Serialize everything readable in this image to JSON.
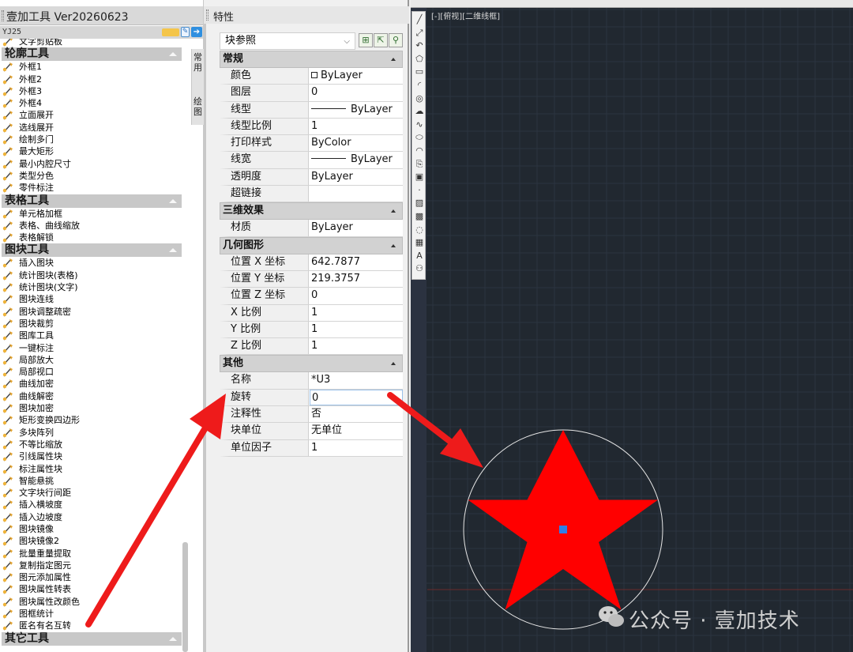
{
  "tool_panel": {
    "title": "壹加工具 Ver20260623",
    "version_tag": "YJ25",
    "badge": "",
    "partial_first_item": "文字剪贴板",
    "categories": [
      {
        "name": "轮廓工具",
        "items": [
          "外框1",
          "外框2",
          "外框3",
          "外框4",
          "立面展开",
          "选线展开",
          "绘制多门",
          "最大矩形",
          "最小内腔尺寸",
          "类型分色",
          "零件标注"
        ]
      },
      {
        "name": "表格工具",
        "items": [
          "单元格加框",
          "表格、曲线缩放",
          "表格解锁"
        ]
      },
      {
        "name": "图块工具",
        "items": [
          "插入图块",
          "统计图块(表格)",
          "统计图块(文字)",
          "图块连线",
          "图块调整疏密",
          "图块裁剪",
          "图库工具",
          "一键标注",
          "局部放大",
          "局部视口",
          "曲线加密",
          "曲线解密",
          "图块加密",
          "矩形变换四边形",
          "多块阵列",
          "不等比缩放",
          "引线属性块",
          "标注属性块",
          "智能悬挑",
          "文字块行间距",
          "插入横坡度",
          "插入边坡度",
          "图块镜像",
          "图块镜像2",
          "批量重量提取",
          "复制指定图元",
          "图元添加属性",
          "图块属性转表",
          "图块属性改颜色",
          "图框统计",
          "匿名有名互转"
        ]
      },
      {
        "name": "其它工具",
        "items": []
      }
    ],
    "side_tabs": [
      "常用",
      "绘图"
    ]
  },
  "properties": {
    "title": "特性",
    "selector_value": "块参照",
    "sections": [
      {
        "name": "常规",
        "rows": [
          {
            "key": "颜色",
            "value": "ByLayer"
          },
          {
            "key": "图层",
            "value": "0"
          },
          {
            "key": "线型",
            "value": "ByLayer"
          },
          {
            "key": "线型比例",
            "value": "1"
          },
          {
            "key": "打印样式",
            "value": "ByColor"
          },
          {
            "key": "线宽",
            "value": "ByLayer"
          },
          {
            "key": "透明度",
            "value": "ByLayer"
          },
          {
            "key": "超链接",
            "value": ""
          }
        ]
      },
      {
        "name": "三维效果",
        "rows": [
          {
            "key": "材质",
            "value": "ByLayer"
          }
        ]
      },
      {
        "name": "几何图形",
        "rows": [
          {
            "key": "位置 X 坐标",
            "value": "642.7877"
          },
          {
            "key": "位置 Y 坐标",
            "value": "219.3757"
          },
          {
            "key": "位置 Z 坐标",
            "value": "0"
          },
          {
            "key": "X 比例",
            "value": "1"
          },
          {
            "key": "Y 比例",
            "value": "1"
          },
          {
            "key": "Z 比例",
            "value": "1"
          }
        ]
      },
      {
        "name": "其他",
        "rows": [
          {
            "key": "名称",
            "value": "*U3"
          },
          {
            "key": "旋转",
            "value": "0"
          },
          {
            "key": "注释性",
            "value": "否"
          },
          {
            "key": "块单位",
            "value": "无单位"
          },
          {
            "key": "单位因子",
            "value": "1"
          }
        ]
      }
    ]
  },
  "canvas": {
    "viewport_label": "[-][俯视][二维线框]",
    "background_color": "#212830",
    "star_color": "#ff0000",
    "circle_color": "#e6e6e6",
    "grip_color": "#2f7fe8",
    "arrow_color": "#ee1b1b"
  },
  "watermark": {
    "text": "公众号 · 壹加技术"
  }
}
